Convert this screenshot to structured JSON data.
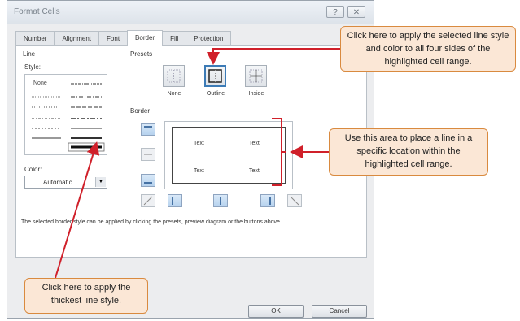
{
  "dialog": {
    "title": "Format Cells",
    "help_glyph": "?",
    "close_glyph": "✕",
    "tabs": [
      "Number",
      "Alignment",
      "Font",
      "Border",
      "Fill",
      "Protection"
    ],
    "active_tab": "Border"
  },
  "line": {
    "group_label": "Line",
    "style_label": "Style:",
    "none_label": "None",
    "color_label": "Color:",
    "color_value": "Automatic"
  },
  "presets": {
    "group_label": "Presets",
    "items": [
      "None",
      "Outline",
      "Inside"
    ]
  },
  "border": {
    "group_label": "Border",
    "cell_text": [
      "Text",
      "Text",
      "Text",
      "Text"
    ]
  },
  "note": "The selected border style can be applied by clicking the presets, preview diagram or the buttons above.",
  "buttons": {
    "ok": "OK",
    "cancel": "Cancel"
  },
  "callouts": {
    "top": "Click here to apply the selected line style and color to all four sides of the highlighted cell range.",
    "middle": "Use this area to place a line in a specific location within the highlighted cell range.",
    "bottom": "Click here to apply the thickest line style."
  },
  "colors": {
    "callout_fill": "#fbe7d6",
    "callout_border": "#d98a3f",
    "arrow": "#d0202a",
    "accent": "#3c7bb6"
  }
}
